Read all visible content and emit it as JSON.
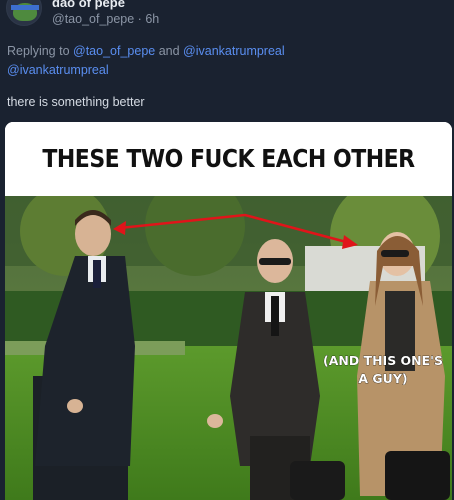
{
  "post": {
    "display_name": "dao of pepe",
    "handle": "@tao_of_pepe",
    "separator": " · ",
    "time": "6h",
    "reply_prefix": "Replying to ",
    "reply_mention_1": "@tao_of_pepe",
    "reply_and": " and ",
    "reply_mention_2": "@ivankatrumpreal",
    "reply_mention_3": "@ivankatrumpreal",
    "text": "there is something better"
  },
  "meme": {
    "caption": "THESE TWO FUCK EACH OTHER",
    "annotation_line1": "(AND THIS ONE'S",
    "annotation_line2": "A GUY)"
  },
  "colors": {
    "background": "#1a2230",
    "mention": "#5a8ef0",
    "arrow": "#e0141a",
    "muted": "#8b95a5"
  }
}
